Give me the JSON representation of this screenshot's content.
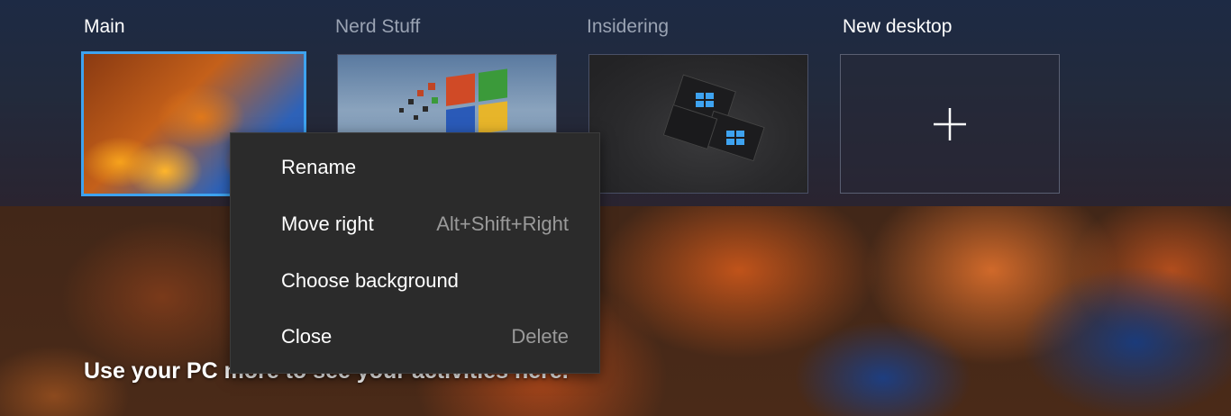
{
  "desktops": [
    {
      "label": "Main",
      "selected": true
    },
    {
      "label": "Nerd Stuff",
      "selected": false
    },
    {
      "label": "Insidering",
      "selected": false
    }
  ],
  "new_desktop": {
    "label": "New desktop",
    "icon": "plus-icon"
  },
  "context_menu": {
    "items": [
      {
        "label": "Rename",
        "shortcut": ""
      },
      {
        "label": "Move right",
        "shortcut": "Alt+Shift+Right"
      },
      {
        "label": "Choose background",
        "shortcut": ""
      },
      {
        "label": "Close",
        "shortcut": "Delete"
      }
    ]
  },
  "activity_message": "Use your PC more to see your activities here.",
  "colors": {
    "selection_border": "#3ea3f0",
    "menu_bg": "#2b2b2b"
  }
}
